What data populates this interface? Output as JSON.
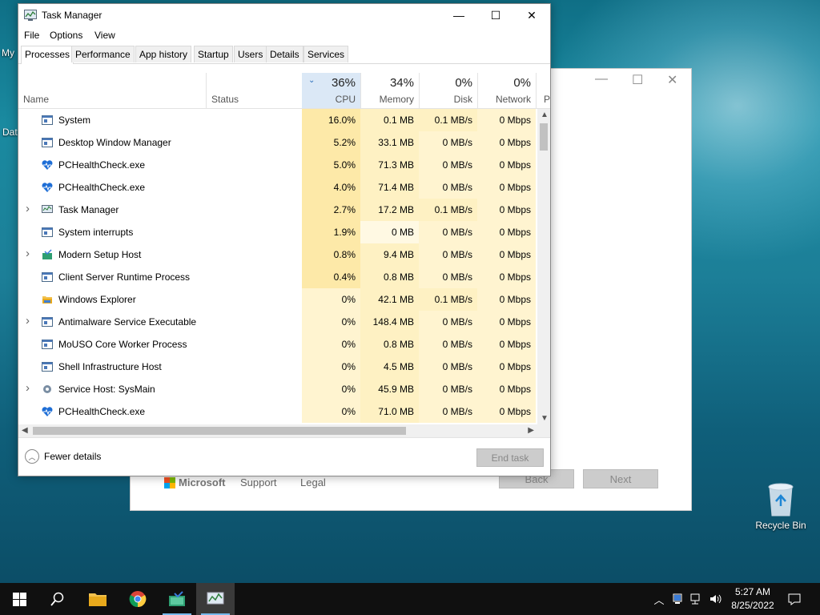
{
  "desktop": {
    "left_labels": [
      "My",
      "Dat"
    ],
    "recycle_bin": "Recycle Bin"
  },
  "background_window": {
    "footer_links": [
      "Microsoft",
      "Support",
      "Legal"
    ],
    "back_label": "Back",
    "next_label": "Next"
  },
  "window": {
    "title": "Task Manager",
    "menu": [
      "File",
      "Options",
      "View"
    ],
    "tabs": [
      "Processes",
      "Performance",
      "App history",
      "Startup",
      "Users",
      "Details",
      "Services"
    ],
    "active_tab": "Processes"
  },
  "columns": {
    "name": "Name",
    "status": "Status",
    "cpu": {
      "pct": "36%",
      "label": "CPU"
    },
    "memory": {
      "pct": "34%",
      "label": "Memory"
    },
    "disk": {
      "pct": "0%",
      "label": "Disk"
    },
    "network": {
      "pct": "0%",
      "label": "Network"
    },
    "power_partial": "P"
  },
  "processes": [
    {
      "name": "System",
      "expandable": false,
      "icon": "system-window-icon",
      "cpu": "16.0%",
      "memory": "0.1 MB",
      "disk": "0.1 MB/s",
      "network": "0 Mbps"
    },
    {
      "name": "Desktop Window Manager",
      "expandable": false,
      "icon": "system-window-icon",
      "cpu": "5.2%",
      "memory": "33.1 MB",
      "disk": "0 MB/s",
      "network": "0 Mbps"
    },
    {
      "name": "PCHealthCheck.exe",
      "expandable": false,
      "icon": "heart-icon",
      "cpu": "5.0%",
      "memory": "71.3 MB",
      "disk": "0 MB/s",
      "network": "0 Mbps"
    },
    {
      "name": "PCHealthCheck.exe",
      "expandable": false,
      "icon": "heart-icon",
      "cpu": "4.0%",
      "memory": "71.4 MB",
      "disk": "0 MB/s",
      "network": "0 Mbps"
    },
    {
      "name": "Task Manager",
      "expandable": true,
      "icon": "task-manager-icon",
      "cpu": "2.7%",
      "memory": "17.2 MB",
      "disk": "0.1 MB/s",
      "network": "0 Mbps"
    },
    {
      "name": "System interrupts",
      "expandable": false,
      "icon": "system-window-icon",
      "cpu": "1.9%",
      "memory": "0 MB",
      "disk": "0 MB/s",
      "network": "0 Mbps"
    },
    {
      "name": "Modern Setup Host",
      "expandable": true,
      "icon": "setup-icon",
      "cpu": "0.8%",
      "memory": "9.4 MB",
      "disk": "0 MB/s",
      "network": "0 Mbps"
    },
    {
      "name": "Client Server Runtime Process",
      "expandable": false,
      "icon": "system-window-icon",
      "cpu": "0.4%",
      "memory": "0.8 MB",
      "disk": "0 MB/s",
      "network": "0 Mbps"
    },
    {
      "name": "Windows Explorer",
      "expandable": false,
      "icon": "folder-icon",
      "cpu": "0%",
      "memory": "42.1 MB",
      "disk": "0.1 MB/s",
      "network": "0 Mbps"
    },
    {
      "name": "Antimalware Service Executable",
      "expandable": true,
      "icon": "system-window-icon",
      "cpu": "0%",
      "memory": "148.4 MB",
      "disk": "0 MB/s",
      "network": "0 Mbps"
    },
    {
      "name": "MoUSO Core Worker Process",
      "expandable": false,
      "icon": "system-window-icon",
      "cpu": "0%",
      "memory": "0.8 MB",
      "disk": "0 MB/s",
      "network": "0 Mbps"
    },
    {
      "name": "Shell Infrastructure Host",
      "expandable": false,
      "icon": "system-window-icon",
      "cpu": "0%",
      "memory": "4.5 MB",
      "disk": "0 MB/s",
      "network": "0 Mbps"
    },
    {
      "name": "Service Host: SysMain",
      "expandable": true,
      "icon": "gear-icon",
      "cpu": "0%",
      "memory": "45.9 MB",
      "disk": "0 MB/s",
      "network": "0 Mbps"
    },
    {
      "name": "PCHealthCheck.exe",
      "expandable": false,
      "icon": "heart-icon",
      "cpu": "0%",
      "memory": "71.0 MB",
      "disk": "0 MB/s",
      "network": "0 Mbps"
    }
  ],
  "footer": {
    "fewer_details": "Fewer details",
    "end_task": "End task"
  },
  "taskbar": {
    "time": "5:27 AM",
    "date": "8/25/2022",
    "pinned": [
      "start-icon",
      "search-icon",
      "file-explorer-icon",
      "chrome-icon",
      "setup-app-icon",
      "task-manager-icon"
    ]
  },
  "colors": {
    "heat_strong": "#fde9a8",
    "heat_medium": "#fef1c3",
    "heat_light": "#fff4d0",
    "accent": "#0078d7"
  }
}
